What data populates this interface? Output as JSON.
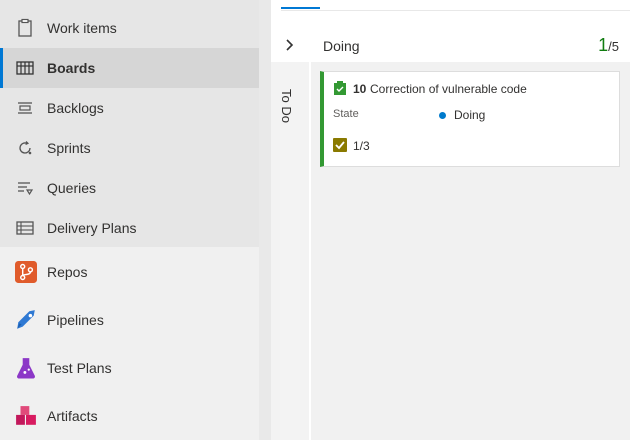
{
  "sidebar": {
    "items": [
      {
        "label": "Work items",
        "icon": "clipboard-icon"
      },
      {
        "label": "Boards",
        "icon": "board-icon",
        "selected": true
      },
      {
        "label": "Backlogs",
        "icon": "backlog-icon"
      },
      {
        "label": "Sprints",
        "icon": "sprint-icon"
      },
      {
        "label": "Queries",
        "icon": "query-icon"
      },
      {
        "label": "Delivery Plans",
        "icon": "delivery-plans-icon"
      },
      {
        "label": "Repos",
        "icon": "repos-icon"
      },
      {
        "label": "Pipelines",
        "icon": "pipelines-icon"
      },
      {
        "label": "Test Plans",
        "icon": "test-plans-icon"
      },
      {
        "label": "Artifacts",
        "icon": "artifacts-icon"
      }
    ]
  },
  "board": {
    "collapsed_column": "To Do",
    "column": {
      "name": "Doing",
      "count": "1",
      "limit": "/5"
    },
    "card": {
      "id": "10",
      "title": "Correction of vulnerable code",
      "state_label": "State",
      "state_value": "Doing",
      "tasks_progress": "1/3"
    }
  },
  "colors": {
    "accent": "#0078d4",
    "card_border": "#339933",
    "count": "#107c10",
    "state_dot": "#007acc"
  }
}
